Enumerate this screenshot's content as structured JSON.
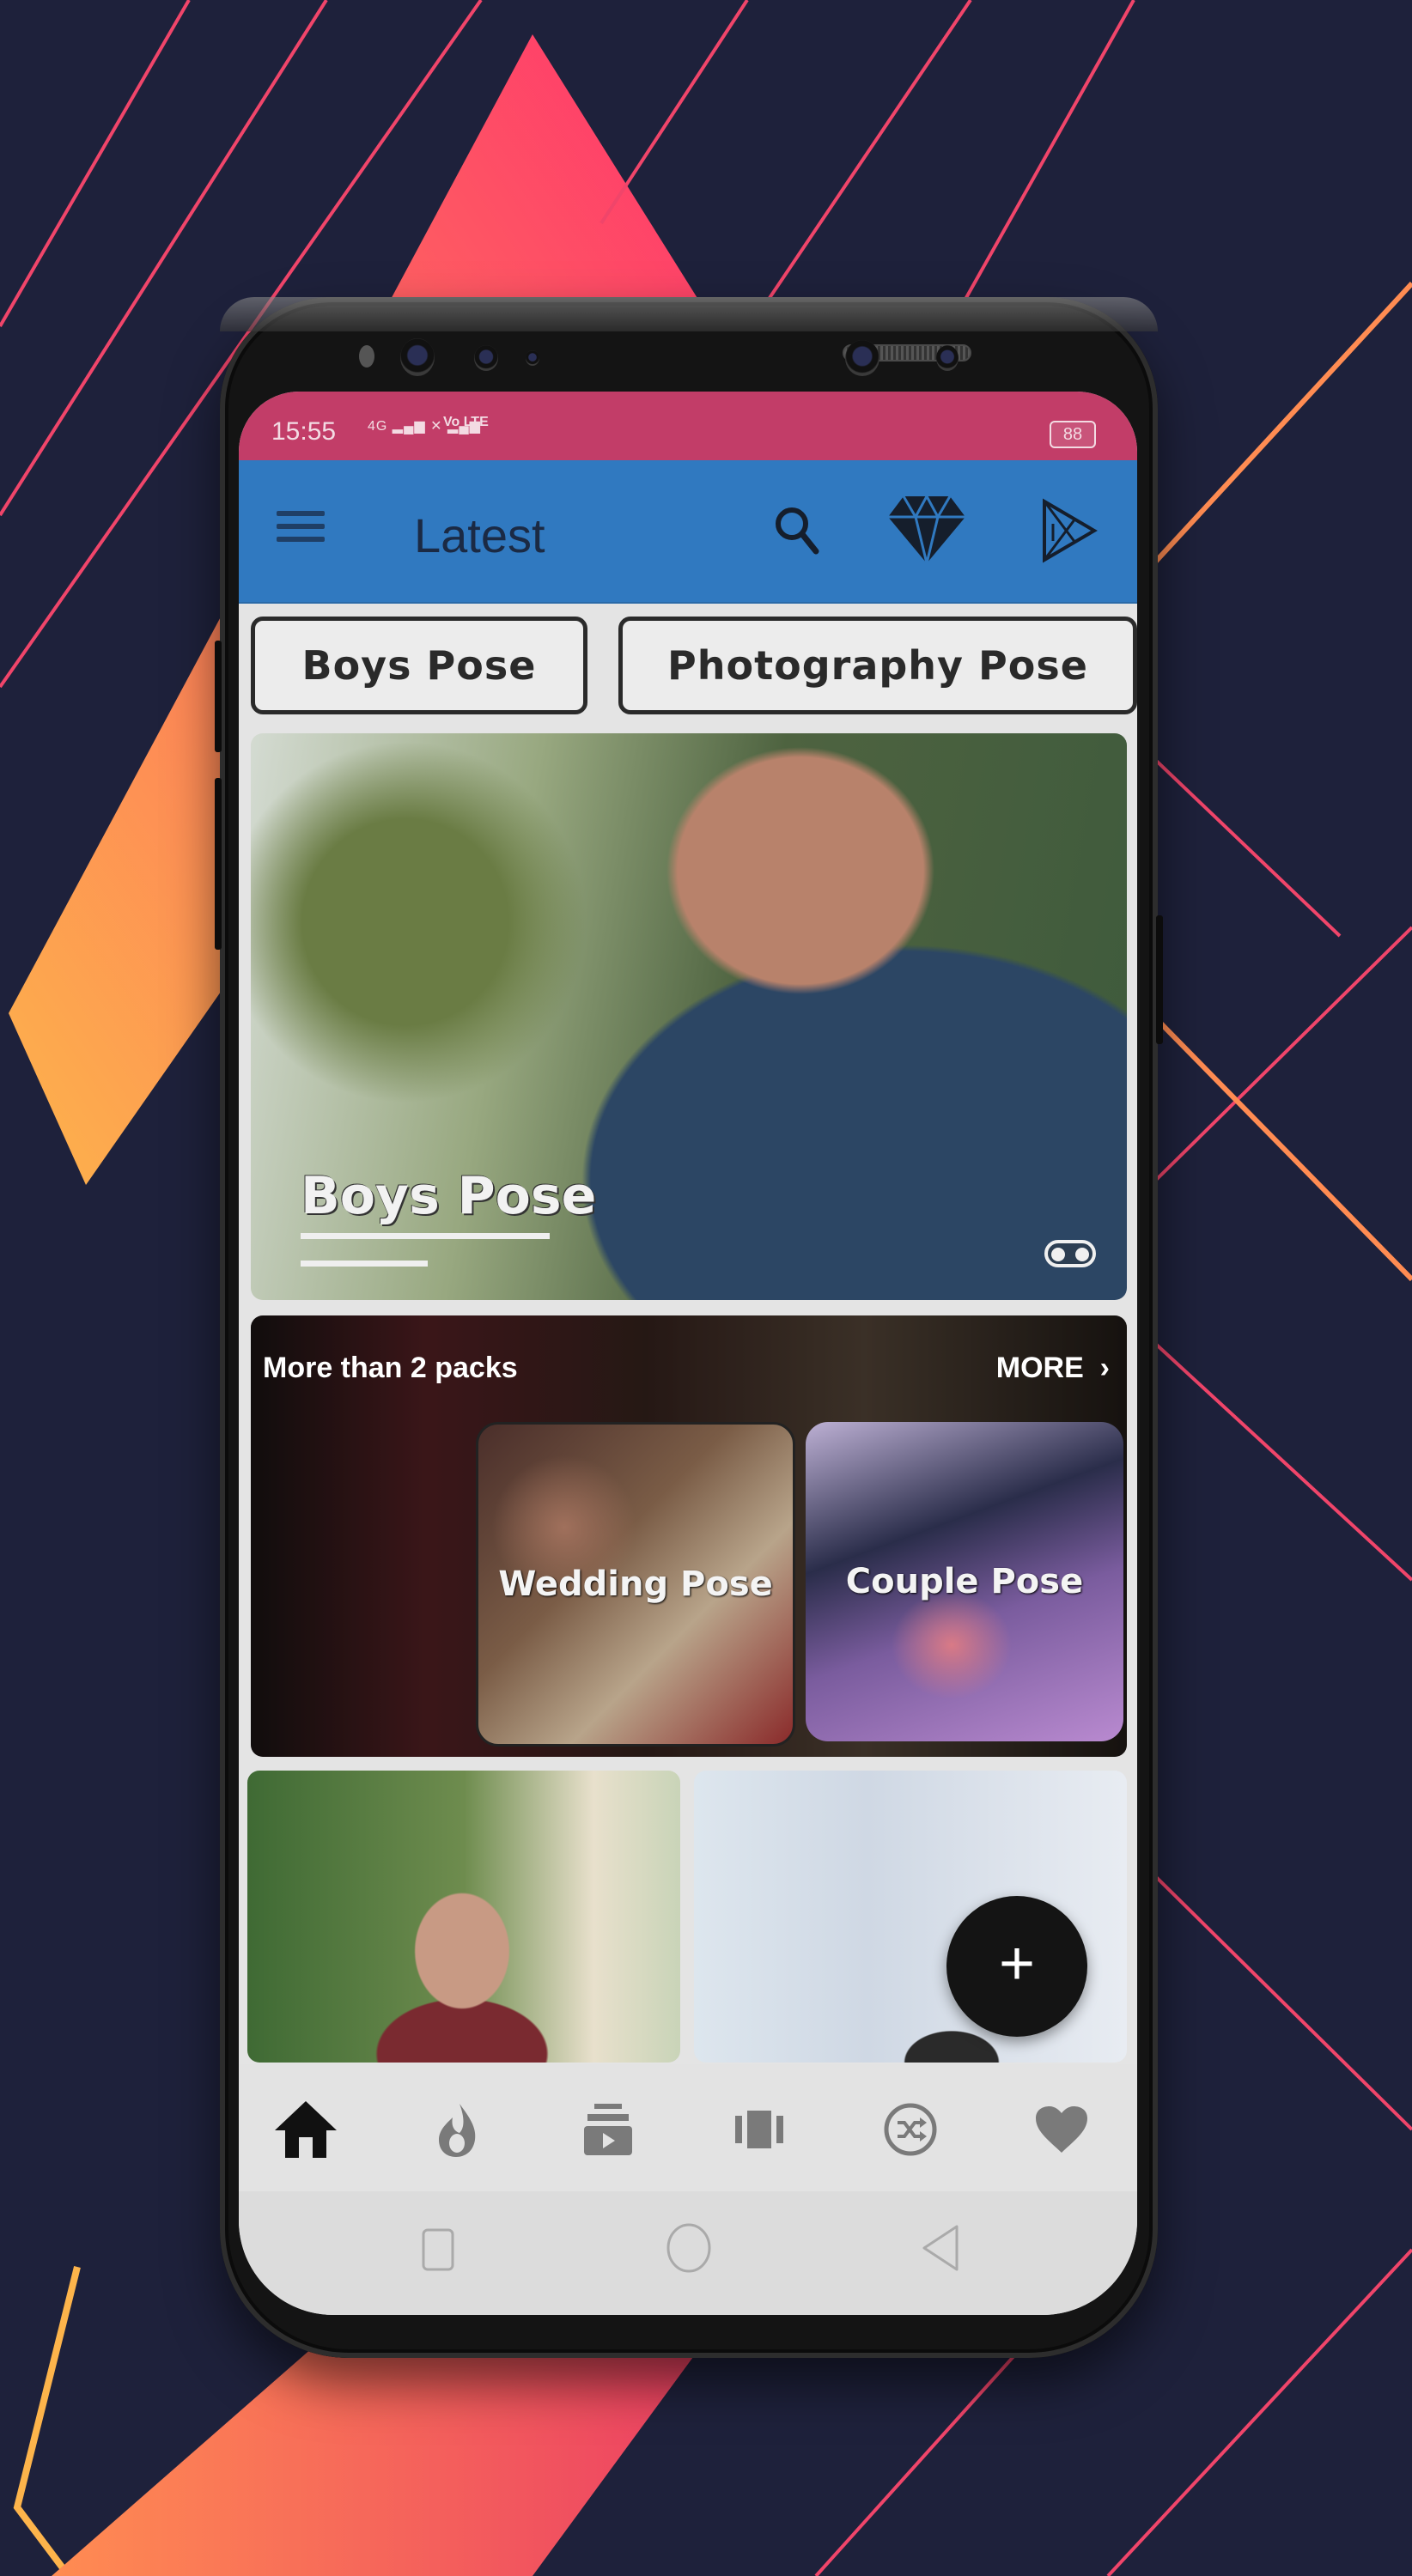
{
  "colors": {
    "background": "#1e213b",
    "status_bar": "#c23d68",
    "app_bar": "#3079c0",
    "screen_bg": "#e4e4e4",
    "active_nav": "#111111",
    "inactive_nav": "#7a7a7a"
  },
  "status_bar": {
    "time": "15:55",
    "network": "4G",
    "volte": "Vo LTE",
    "battery": "88"
  },
  "app_bar": {
    "title": "Latest",
    "icons": [
      "menu-icon",
      "search-icon",
      "diamond-icon",
      "play-store-icon"
    ]
  },
  "categories": [
    {
      "label": "Boys Pose"
    },
    {
      "label": "Photography Pose"
    }
  ],
  "hero": {
    "title": "Boys Pose",
    "icon": "toggle-icon"
  },
  "packs_section": {
    "label": "More than 2 packs",
    "more_label": "MORE",
    "more_icon": "chevron-right-icon",
    "items": [
      {
        "label": "Wedding Pose"
      },
      {
        "label": "Couple Pose"
      }
    ]
  },
  "fab": {
    "label": "+",
    "icon": "plus-icon"
  },
  "bottom_nav": {
    "items": [
      {
        "icon": "home-icon",
        "active": true
      },
      {
        "icon": "fire-icon",
        "active": false
      },
      {
        "icon": "video-library-icon",
        "active": false
      },
      {
        "icon": "carousel-icon",
        "active": false
      },
      {
        "icon": "shuffle-icon",
        "active": false
      },
      {
        "icon": "heart-icon",
        "active": false
      }
    ]
  },
  "system_nav": {
    "items": [
      "recents-icon",
      "home-circle-icon",
      "back-icon"
    ]
  }
}
